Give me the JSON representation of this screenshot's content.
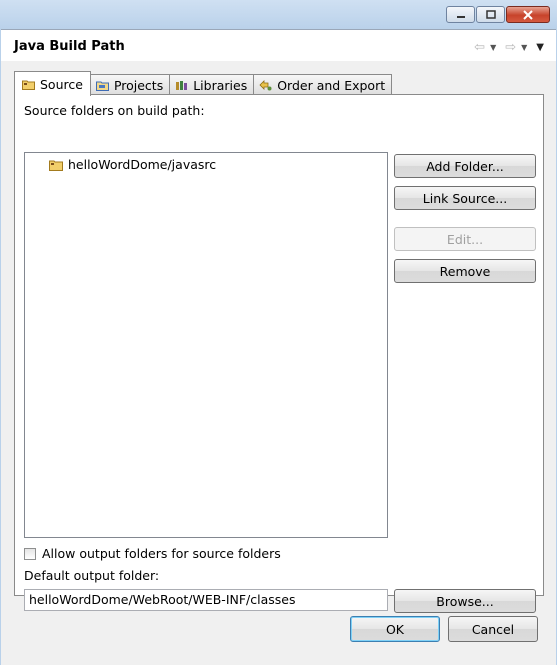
{
  "window": {
    "title": "Java Build Path"
  },
  "tabs": [
    {
      "label": "Source",
      "icon": "source-folder-icon",
      "active": true
    },
    {
      "label": "Projects",
      "icon": "projects-icon",
      "active": false
    },
    {
      "label": "Libraries",
      "icon": "libraries-icon",
      "active": false
    },
    {
      "label": "Order and Export",
      "icon": "order-export-icon",
      "active": false
    }
  ],
  "source": {
    "tree_label": "Source folders on build path:",
    "items": [
      {
        "label": "helloWordDome/javasrc",
        "icon": "source-folder-icon"
      }
    ],
    "buttons": {
      "add_folder": "Add Folder...",
      "link_source": "Link Source...",
      "edit": "Edit...",
      "remove": "Remove"
    },
    "allow_output_label": "Allow output folders for source folders",
    "allow_output_checked": false,
    "default_output_label": "Default output folder:",
    "default_output_value": "helloWordDome/WebRoot/WEB-INF/classes",
    "browse": "Browse..."
  },
  "dialog": {
    "ok": "OK",
    "cancel": "Cancel"
  },
  "colors": {
    "window_frame": "#b9d1ea",
    "panel": "#ffffff",
    "client": "#f0f0f0",
    "default_button": "#3c7fb1",
    "close_button": "#c7432b"
  }
}
